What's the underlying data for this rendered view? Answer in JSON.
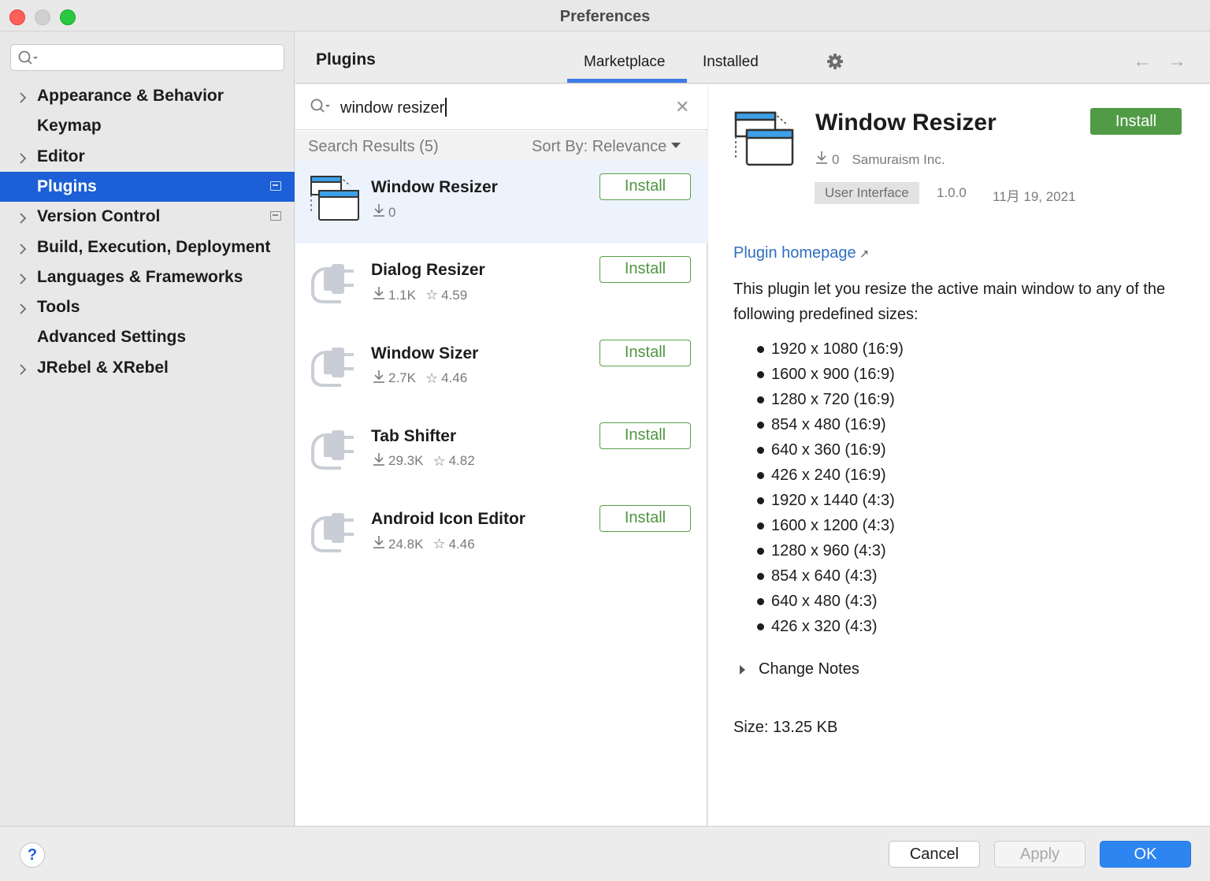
{
  "window": {
    "title": "Preferences"
  },
  "sidebar": {
    "search_placeholder": "",
    "items": [
      {
        "label": "Appearance & Behavior",
        "expandable": true
      },
      {
        "label": "Keymap",
        "expandable": false
      },
      {
        "label": "Editor",
        "expandable": true
      },
      {
        "label": "Plugins",
        "expandable": false,
        "selected": true
      },
      {
        "label": "Version Control",
        "expandable": true
      },
      {
        "label": "Build, Execution, Deployment",
        "expandable": true
      },
      {
        "label": "Languages & Frameworks",
        "expandable": true
      },
      {
        "label": "Tools",
        "expandable": true
      },
      {
        "label": "Advanced Settings",
        "expandable": false
      },
      {
        "label": "JRebel & XRebel",
        "expandable": true
      }
    ]
  },
  "header": {
    "title": "Plugins",
    "tabs": [
      {
        "label": "Marketplace",
        "active": true
      },
      {
        "label": "Installed",
        "active": false
      }
    ],
    "back_arrow": "←",
    "forward_arrow": "→"
  },
  "search": {
    "query": "window resizer",
    "clear_glyph": "✕",
    "results_label": "Search Results (5)",
    "sort_label": "Sort By: Relevance"
  },
  "results": [
    {
      "name": "Window Resizer",
      "downloads": "0",
      "rating": "",
      "button": "Install",
      "icon": "window-resizer-icon",
      "selected": true
    },
    {
      "name": "Dialog Resizer",
      "downloads": "1.1K",
      "rating": "4.59",
      "button": "Install",
      "icon": "plugin-plug-icon"
    },
    {
      "name": "Window Sizer",
      "downloads": "2.7K",
      "rating": "4.46",
      "button": "Install",
      "icon": "plugin-plug-icon"
    },
    {
      "name": "Tab Shifter",
      "downloads": "29.3K",
      "rating": "4.82",
      "button": "Install",
      "icon": "plugin-plug-icon"
    },
    {
      "name": "Android Icon Editor",
      "downloads": "24.8K",
      "rating": "4.46",
      "button": "Install",
      "icon": "plugin-plug-icon"
    }
  ],
  "detail": {
    "name": "Window Resizer",
    "install_label": "Install",
    "downloads": "0",
    "vendor": "Samuraism Inc.",
    "tag": "User Interface",
    "version": "1.0.0",
    "date": "11月 19, 2021",
    "homepage_label": "Plugin homepage",
    "homepage_arrow": "↗",
    "description": "This plugin let you resize the active main window to any of the following predefined sizes:",
    "sizes": [
      "1920 x 1080 (16:9)",
      "1600 x 900 (16:9)",
      "1280 x 720 (16:9)",
      "854 x 480 (16:9)",
      "640 x 360 (16:9)",
      "426 x 240 (16:9)",
      "1920 x 1440 (4:3)",
      "1600 x 1200 (4:3)",
      "1280 x 960 (4:3)",
      "854 x 640 (4:3)",
      "640 x 480 (4:3)",
      "426 x 320 (4:3)"
    ],
    "change_notes_label": "Change Notes",
    "size_label": "Size: 13.25 KB"
  },
  "footer": {
    "help_label": "?",
    "cancel_label": "Cancel",
    "apply_label": "Apply",
    "ok_label": "OK"
  },
  "colors": {
    "selection_blue": "#1c5fd6",
    "install_green": "#519b46",
    "ok_blue": "#2d85f1",
    "link_blue": "#2f6fbf",
    "tab_underline": "#3c7be5"
  }
}
